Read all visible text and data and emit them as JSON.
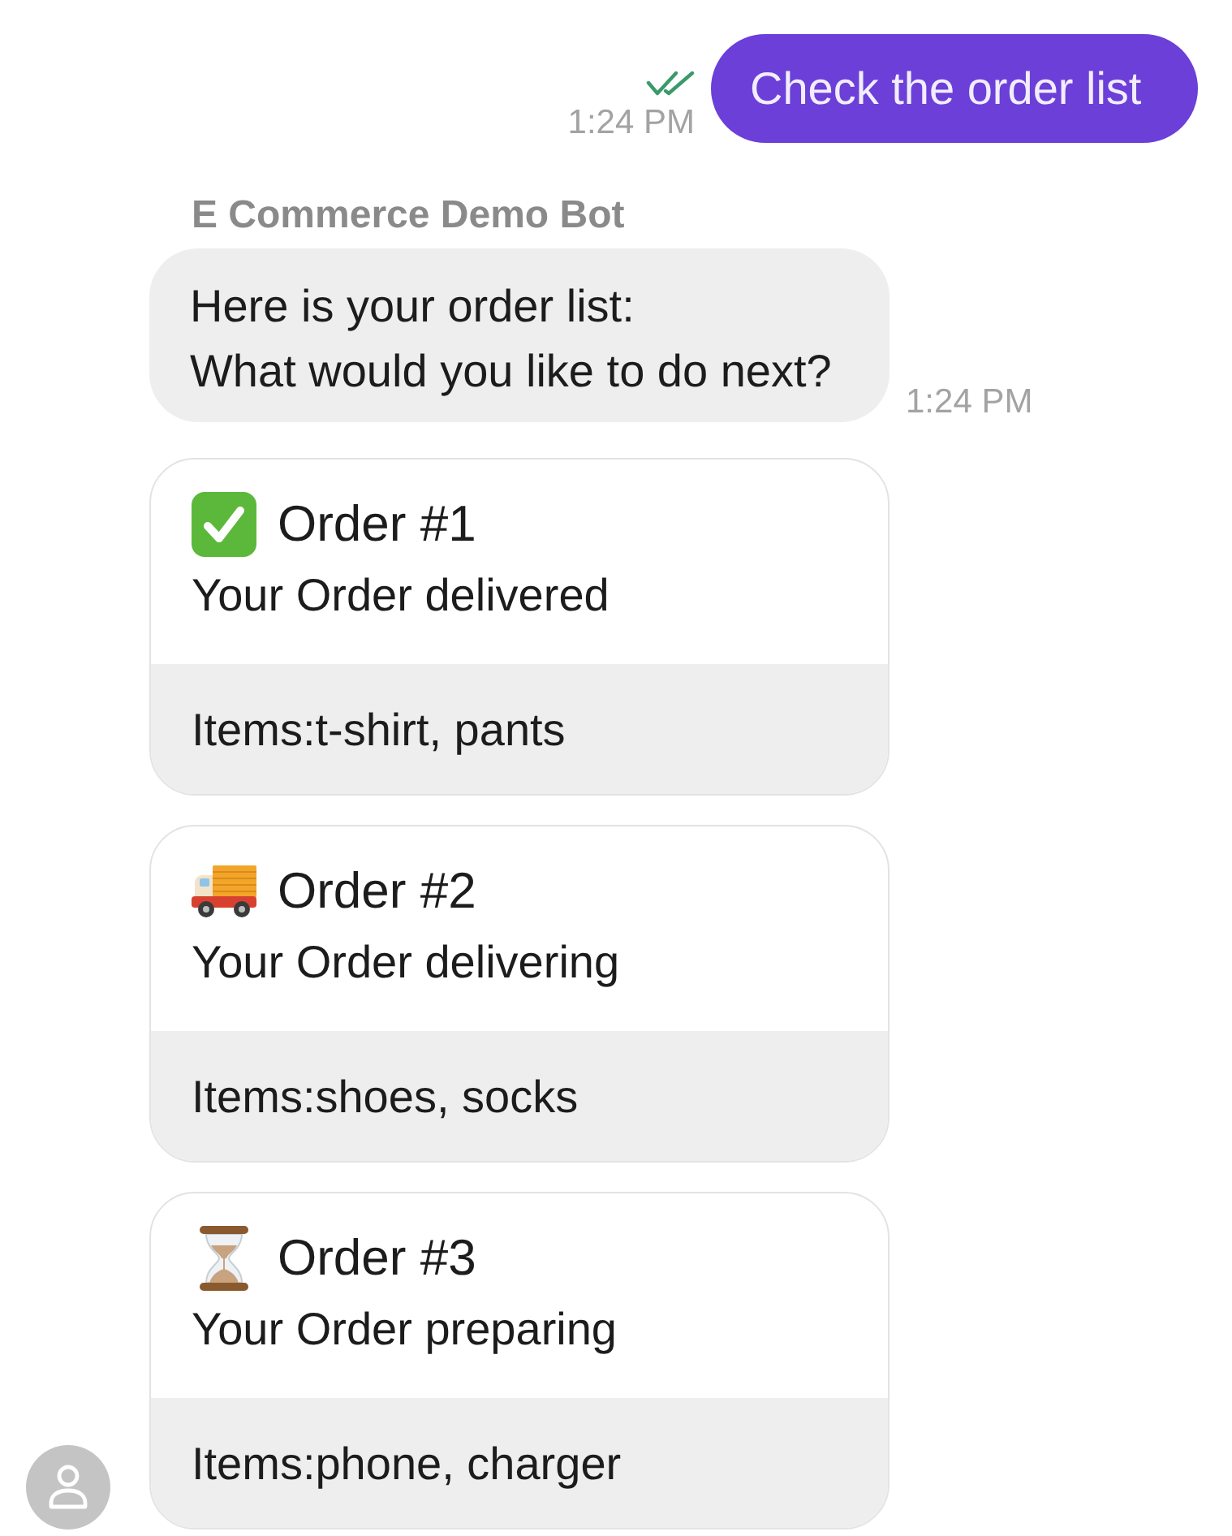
{
  "outgoing_message": {
    "text": "Check the order list",
    "time": "1:24 PM",
    "read": true
  },
  "bot": {
    "sender": "E Commerce Demo Bot",
    "message": "Here is your order list:\nWhat would you like to do next?",
    "time": "1:24 PM"
  },
  "orders": [
    {
      "kind": "delivered",
      "title": "Order #1",
      "status": "Your Order delivered",
      "items": "Items:t-shirt, pants"
    },
    {
      "kind": "delivering",
      "title": "Order #2",
      "status": "Your Order delivering",
      "items": "Items:shoes, socks"
    },
    {
      "kind": "preparing",
      "title": "Order #3",
      "status": "Your Order preparing",
      "items": "Items:phone, charger"
    }
  ]
}
